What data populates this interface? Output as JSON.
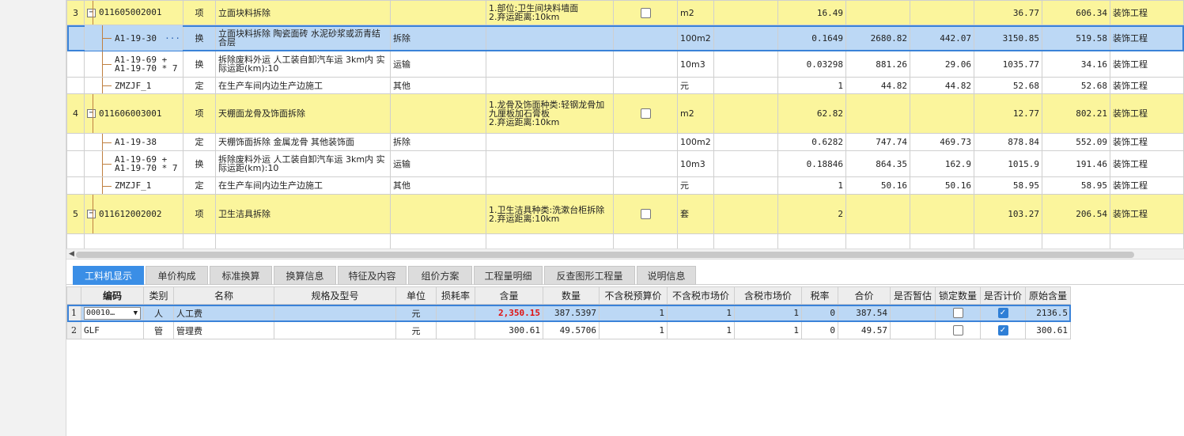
{
  "upper_rows": [
    {
      "seq": "3",
      "code": "011605002001",
      "type": "项",
      "name": "立面块料拆除",
      "spec": "1.部位:卫生间块料墙面\n2.弃运距离:10km",
      "checked": false,
      "unit": "m2",
      "qty": "16.49",
      "p1": "",
      "p2": "",
      "p3": "36.77",
      "total": "606.34",
      "cat": "装饰工程",
      "kind": "item"
    },
    {
      "seq": "",
      "code": "A1-19-30",
      "type": "换",
      "name": "立面块料拆除 陶瓷面砖 水泥砂浆或沥青结合层",
      "spec": "",
      "extra": "拆除",
      "unit": "100m2",
      "qty": "0.1649",
      "p1": "2680.82",
      "p2": "442.07",
      "p3": "3150.85",
      "total": "519.58",
      "cat": "装饰工程",
      "kind": "sel"
    },
    {
      "seq": "",
      "code": "A1-19-69 + A1-19-70 * 7",
      "type": "换",
      "name": "拆除废料外运 人工装自卸汽车运 3km内 实际运距(km):10",
      "spec": "",
      "extra": "运输",
      "unit": "10m3",
      "qty": "0.03298",
      "p1": "881.26",
      "p2": "29.06",
      "p3": "1035.77",
      "total": "34.16",
      "cat": "装饰工程",
      "kind": "sub"
    },
    {
      "seq": "",
      "code": "ZMZJF_1",
      "type": "定",
      "name": "在生产车间内边生产边施工",
      "spec": "",
      "extra": "其他",
      "unit": "元",
      "qty": "1",
      "p1": "44.82",
      "p2": "44.82",
      "p3": "52.68",
      "total": "52.68",
      "cat": "装饰工程",
      "kind": "sub"
    },
    {
      "seq": "4",
      "code": "011606003001",
      "type": "项",
      "name": "天棚面龙骨及饰面拆除",
      "spec": "1.龙骨及饰面种类:轻钢龙骨加九厘板加石膏板\n2.弃运距离:10km",
      "checked": false,
      "unit": "m2",
      "qty": "62.82",
      "p1": "",
      "p2": "",
      "p3": "12.77",
      "total": "802.21",
      "cat": "装饰工程",
      "kind": "item"
    },
    {
      "seq": "",
      "code": "A1-19-38",
      "type": "定",
      "name": "天棚饰面拆除 金属龙骨 其他装饰面",
      "spec": "",
      "extra": "拆除",
      "unit": "100m2",
      "qty": "0.6282",
      "p1": "747.74",
      "p2": "469.73",
      "p3": "878.84",
      "total": "552.09",
      "cat": "装饰工程",
      "kind": "sub"
    },
    {
      "seq": "",
      "code": "A1-19-69 + A1-19-70 * 7",
      "type": "换",
      "name": "拆除废料外运 人工装自卸汽车运 3km内 实际运距(km):10",
      "spec": "",
      "extra": "运输",
      "unit": "10m3",
      "qty": "0.18846",
      "p1": "864.35",
      "p2": "162.9",
      "p3": "1015.9",
      "total": "191.46",
      "cat": "装饰工程",
      "kind": "sub"
    },
    {
      "seq": "",
      "code": "ZMZJF_1",
      "type": "定",
      "name": "在生产车间内边生产边施工",
      "spec": "",
      "extra": "其他",
      "unit": "元",
      "qty": "1",
      "p1": "50.16",
      "p2": "50.16",
      "p3": "58.95",
      "total": "58.95",
      "cat": "装饰工程",
      "kind": "sub"
    },
    {
      "seq": "5",
      "code": "011612002002",
      "type": "项",
      "name": "卫生洁具拆除",
      "spec": "1.卫生洁具种类:洗漱台柜拆除\n2.弃运距离:10km",
      "checked": false,
      "unit": "套",
      "qty": "2",
      "p1": "",
      "p2": "",
      "p3": "103.27",
      "total": "206.54",
      "cat": "装饰工程",
      "kind": "item"
    }
  ],
  "tabs": [
    "工料机显示",
    "单价构成",
    "标准换算",
    "换算信息",
    "特征及内容",
    "组价方案",
    "工程量明细",
    "反查图形工程量",
    "说明信息"
  ],
  "lower_headers": [
    "编码",
    "类别",
    "名称",
    "规格及型号",
    "单位",
    "损耗率",
    "含量",
    "数量",
    "不含税预算价",
    "不含税市场价",
    "含税市场价",
    "税率",
    "合价",
    "是否暂估",
    "锁定数量",
    "是否计价",
    "原始含量"
  ],
  "lower_rows": [
    {
      "no": "1",
      "code": "00010…",
      "cat": "人",
      "name": "人工费",
      "spec": "",
      "unit": "元",
      "loss": "",
      "content": "2,350.15",
      "qty": "387.5397",
      "p1": "1",
      "p2": "1",
      "p3": "1",
      "tax": "0",
      "sum": "387.54",
      "est": "",
      "lock": false,
      "priced": true,
      "orig": "2136.5"
    },
    {
      "no": "2",
      "code": "GLF",
      "cat": "管",
      "name": "管理费",
      "spec": "",
      "unit": "元",
      "loss": "",
      "content": "300.61",
      "qty": "49.5706",
      "p1": "1",
      "p2": "1",
      "p3": "1",
      "tax": "0",
      "sum": "49.57",
      "est": "",
      "lock": false,
      "priced": true,
      "orig": "300.61"
    }
  ],
  "colors": {
    "yellow_row": "#fbf59c",
    "selected_row": "#bcd8f5",
    "tab_active": "#3a8ee6",
    "red_value": "#e01010"
  }
}
